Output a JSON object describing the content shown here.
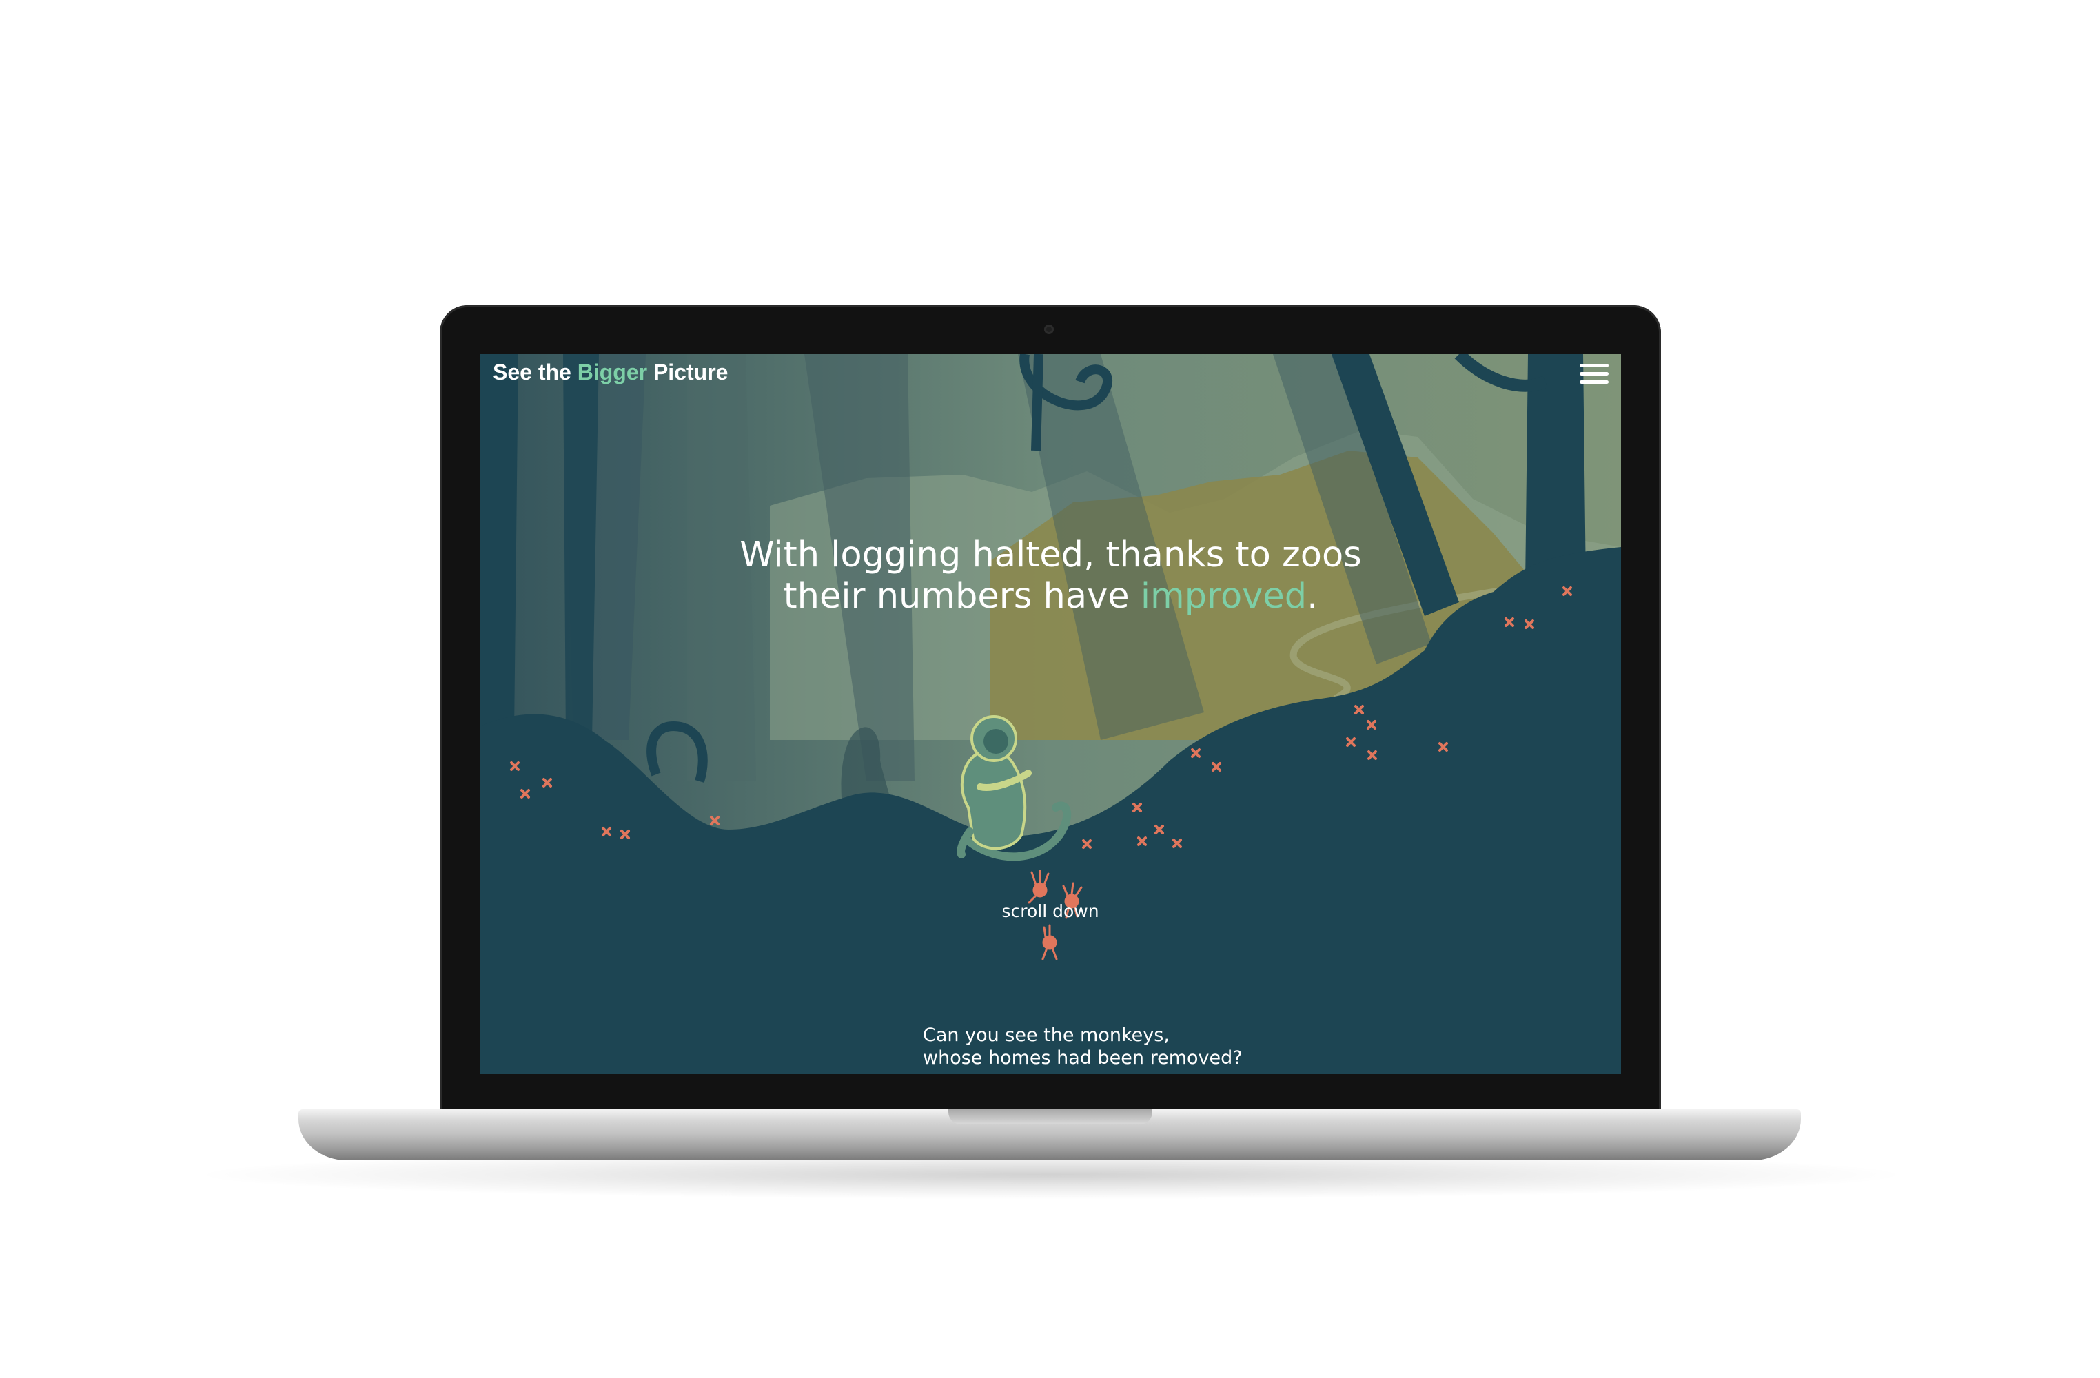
{
  "header": {
    "brand_prefix": "See the",
    "brand_accent": "Bigger",
    "brand_suffix": "Picture",
    "menu_icon": "hamburger-menu-icon"
  },
  "hero": {
    "line1": "With logging halted, thanks to zoos",
    "line2_prefix": "their numbers have",
    "line2_accent": "improved",
    "line2_suffix": "."
  },
  "scroll_prompt": {
    "label": "scroll down",
    "icon": "monkey-handprints-icon"
  },
  "caption": {
    "line1": "Can you see the monkeys,",
    "line2": "whose homes had been removed?"
  },
  "colors": {
    "background": "#1d4553",
    "accent": "#7dcfa7",
    "flowers": "#e0765c",
    "sky": "#6f8a78",
    "hills": "#8b874c",
    "text": "#ffffff"
  }
}
